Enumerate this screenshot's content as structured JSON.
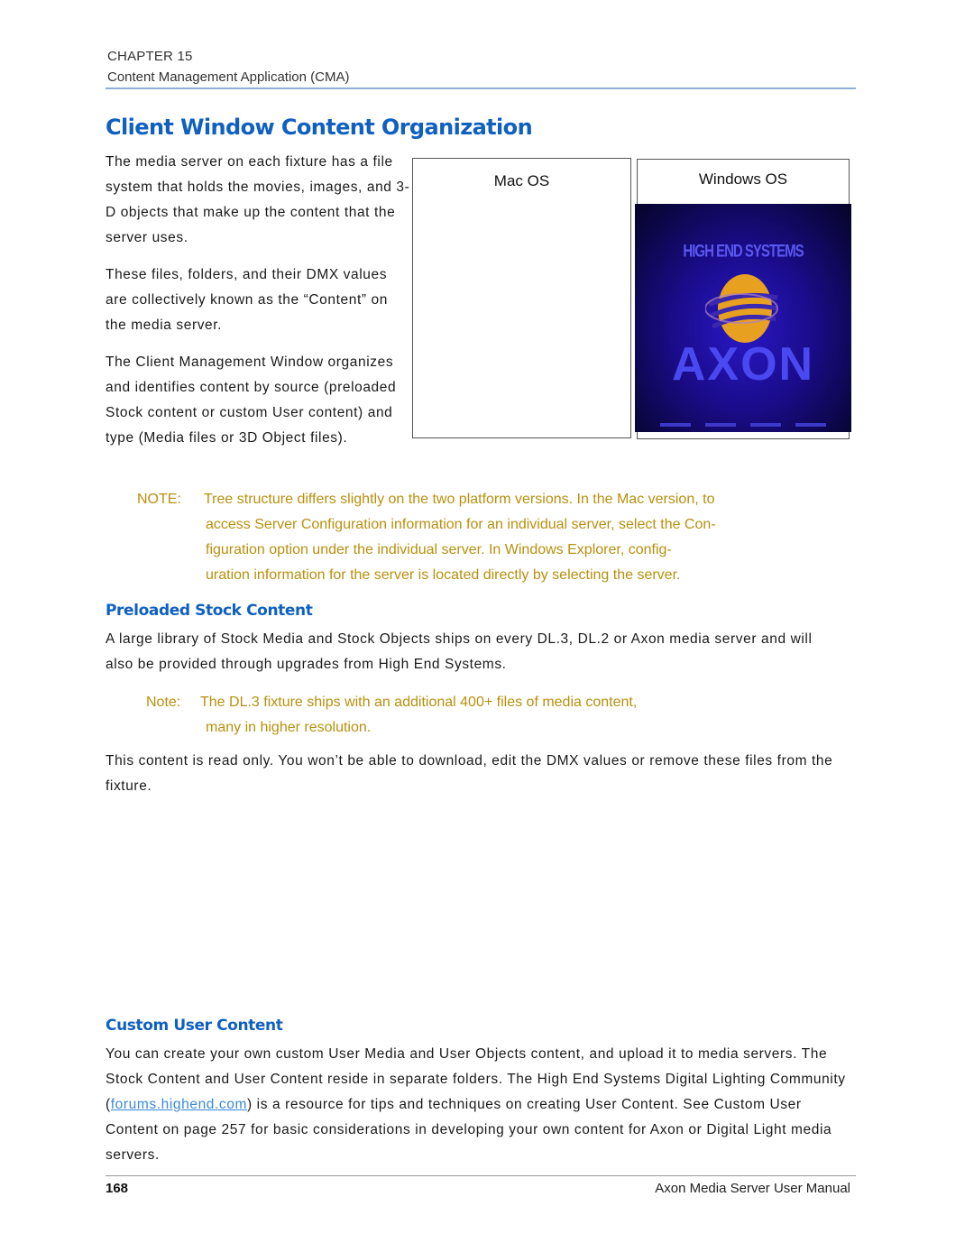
{
  "header": {
    "chapter": "CHAPTER 15",
    "chapter_title": "Content Management Application (CMA)"
  },
  "section": {
    "title": "Client Window Content Organization",
    "paragraphs": [
      "The media server on each fixture has a file system that holds the movies, images, and 3-D objects that make up the content that the server uses.",
      "These files, folders, and their DMX values are collectively known as the “Content” on the media server.",
      "The Client Management Window organizes and identifies content by source (preloaded Stock content or custom User content) and type (Media files or 3D Object files)."
    ],
    "figures": {
      "mac_label": "Mac OS",
      "windows_label": "Windows OS",
      "splash_brand": "HIGH END SYSTEMS",
      "splash_title": "AXON"
    },
    "note": {
      "label": "NOTE:",
      "lines": [
        "Tree structure differs slightly on the two platform versions. In the Mac version, to",
        "access Server Configuration information for an individual server, select the Con-",
        "figuration option under the individual server.  In Windows Explorer, config-",
        "uration information for the server is located directly by selecting the server."
      ]
    }
  },
  "stock": {
    "title": "Preloaded Stock Content",
    "paragraph": "A large library of Stock Media and Stock Objects ships on every DL.3, DL.2 or Axon media server and will also be provided through upgrades from High End Systems.",
    "note": {
      "label": "Note:",
      "lines": [
        "The DL.3 fixture ships with an additional 400+ files of media content,",
        "many in higher resolution."
      ]
    },
    "paragraph2": "This content is read only. You won’t be able to download, edit the DMX values or remove these files from the fixture."
  },
  "custom": {
    "title": "Custom User Content",
    "text_before_link": "You can create your own custom User Media and User Objects content, and upload it to media servers. The Stock Content and User Content reside in separate folders. The High End Systems Digital Lighting Community (",
    "link_text": "forums.highend.com",
    "text_after_link": ") is a resource for tips and techniques on creating User Content. See ",
    "xref_text": "Custom User Content",
    "text_end": " on page 257 for basic considerations in developing your own content for Axon or Digital Light media servers."
  },
  "footer": {
    "page_number": "168",
    "manual_title": "Axon Media Server User Manual"
  },
  "colors": {
    "heading": "#1060c0",
    "note": "#b8900e",
    "link": "#3a8ad8",
    "rule": "#8fb0d0"
  }
}
